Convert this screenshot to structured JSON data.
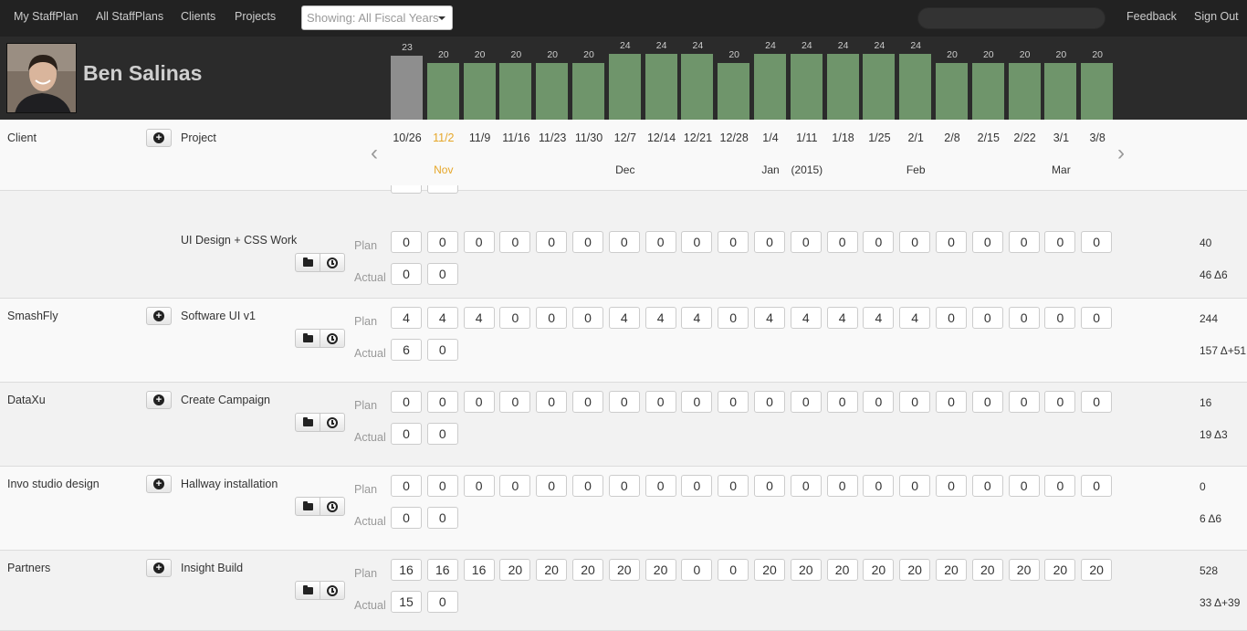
{
  "nav": {
    "items": [
      "My StaffPlan",
      "All StaffPlans",
      "Clients",
      "Projects"
    ],
    "fiscal_select": "Showing: All Fiscal Years",
    "search_value": "",
    "feedback": "Feedback",
    "signout": "Sign Out"
  },
  "user": {
    "name": "Ben Salinas"
  },
  "columns": {
    "client": "Client",
    "project": "Project"
  },
  "colors": {
    "bar": "#6f956b",
    "bar_current": "#8e8e8e",
    "current_week": "#e6a72a"
  },
  "weeks": [
    "10/26",
    "11/2",
    "11/9",
    "11/16",
    "11/23",
    "11/30",
    "12/7",
    "12/14",
    "12/21",
    "12/28",
    "1/4",
    "1/11",
    "1/18",
    "1/25",
    "2/1",
    "2/8",
    "2/15",
    "2/22",
    "3/1",
    "3/8"
  ],
  "months": [
    {
      "label": "Nov",
      "week_index": 1,
      "current": true
    },
    {
      "label": "Dec",
      "week_index": 6
    },
    {
      "label": "Jan",
      "week_index": 10
    },
    {
      "label": "(2015)",
      "week_index": 11
    },
    {
      "label": "Feb",
      "week_index": 14
    },
    {
      "label": "Mar",
      "week_index": 18
    }
  ],
  "weekly_totals": {
    "current_index": 0,
    "values": [
      23,
      20,
      20,
      20,
      20,
      20,
      24,
      24,
      24,
      20,
      24,
      24,
      24,
      24,
      24,
      20,
      20,
      20,
      20,
      20
    ]
  },
  "row_labels": {
    "plan": "Plan",
    "actual": "Actual"
  },
  "rows": [
    {
      "client": "",
      "project": "UI Design + CSS Work",
      "plan": [
        0,
        0,
        0,
        0,
        0,
        0,
        0,
        0,
        0,
        0,
        0,
        0,
        0,
        0,
        0,
        0,
        0,
        0,
        0,
        0
      ],
      "actual": [
        0,
        0
      ],
      "plan_total": "40",
      "actual_total": "46 Δ6"
    },
    {
      "client": "SmashFly",
      "project": "Software UI v1",
      "plan": [
        4,
        4,
        4,
        0,
        0,
        0,
        4,
        4,
        4,
        0,
        4,
        4,
        4,
        4,
        4,
        0,
        0,
        0,
        0,
        0
      ],
      "actual": [
        6,
        0
      ],
      "plan_total": "244",
      "actual_total": "157 Δ+51"
    },
    {
      "client": "DataXu",
      "project": "Create Campaign",
      "plan": [
        0,
        0,
        0,
        0,
        0,
        0,
        0,
        0,
        0,
        0,
        0,
        0,
        0,
        0,
        0,
        0,
        0,
        0,
        0,
        0
      ],
      "actual": [
        0,
        0
      ],
      "plan_total": "16",
      "actual_total": "19 Δ3"
    },
    {
      "client": "Invo studio design",
      "project": "Hallway installation",
      "plan": [
        0,
        0,
        0,
        0,
        0,
        0,
        0,
        0,
        0,
        0,
        0,
        0,
        0,
        0,
        0,
        0,
        0,
        0,
        0,
        0
      ],
      "actual": [
        0,
        0
      ],
      "plan_total": "0",
      "actual_total": "6 Δ6"
    },
    {
      "client": "Partners",
      "project": "Insight Build",
      "plan": [
        16,
        16,
        16,
        20,
        20,
        20,
        20,
        20,
        0,
        0,
        20,
        20,
        20,
        20,
        20,
        20,
        20,
        20,
        20,
        20
      ],
      "actual": [
        15,
        0
      ],
      "plan_total": "528",
      "actual_total": "33 Δ+39"
    }
  ]
}
